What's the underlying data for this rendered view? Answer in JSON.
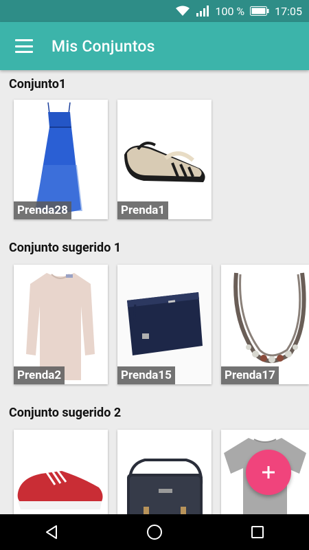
{
  "status_bar": {
    "wifi_icon": "wifi-icon",
    "signal_icon": "signal-icon",
    "battery_percent": "100 %",
    "battery_icon": "battery-icon",
    "time": "17:05"
  },
  "app_bar": {
    "menu_icon": "hamburger-menu-icon",
    "title": "Mis Conjuntos",
    "background": "#3cb4aa"
  },
  "sections": [
    {
      "title": "Conjunto1",
      "items": [
        {
          "label": "Prenda28",
          "image": "blue-maxi-dress"
        },
        {
          "label": "Prenda1",
          "image": "sandals"
        }
      ]
    },
    {
      "title": "Conjunto sugerido 1",
      "items": [
        {
          "label": "Prenda2",
          "image": "pink-sweater-dress"
        },
        {
          "label": "Prenda15",
          "image": "navy-clutch"
        },
        {
          "label": "Prenda17",
          "image": "beaded-necklace"
        }
      ]
    },
    {
      "title": "Conjunto sugerido 2",
      "items": [
        {
          "label": "",
          "image": "red-sneaker"
        },
        {
          "label": "",
          "image": "black-messenger-bag"
        },
        {
          "label": "",
          "image": "grey-tshirt"
        }
      ]
    }
  ],
  "fab": {
    "icon": "plus-icon",
    "color": "#f0447c"
  },
  "nav_bar": {
    "back_icon": "back-triangle-icon",
    "home_icon": "home-circle-icon",
    "recents_icon": "recents-square-icon"
  }
}
